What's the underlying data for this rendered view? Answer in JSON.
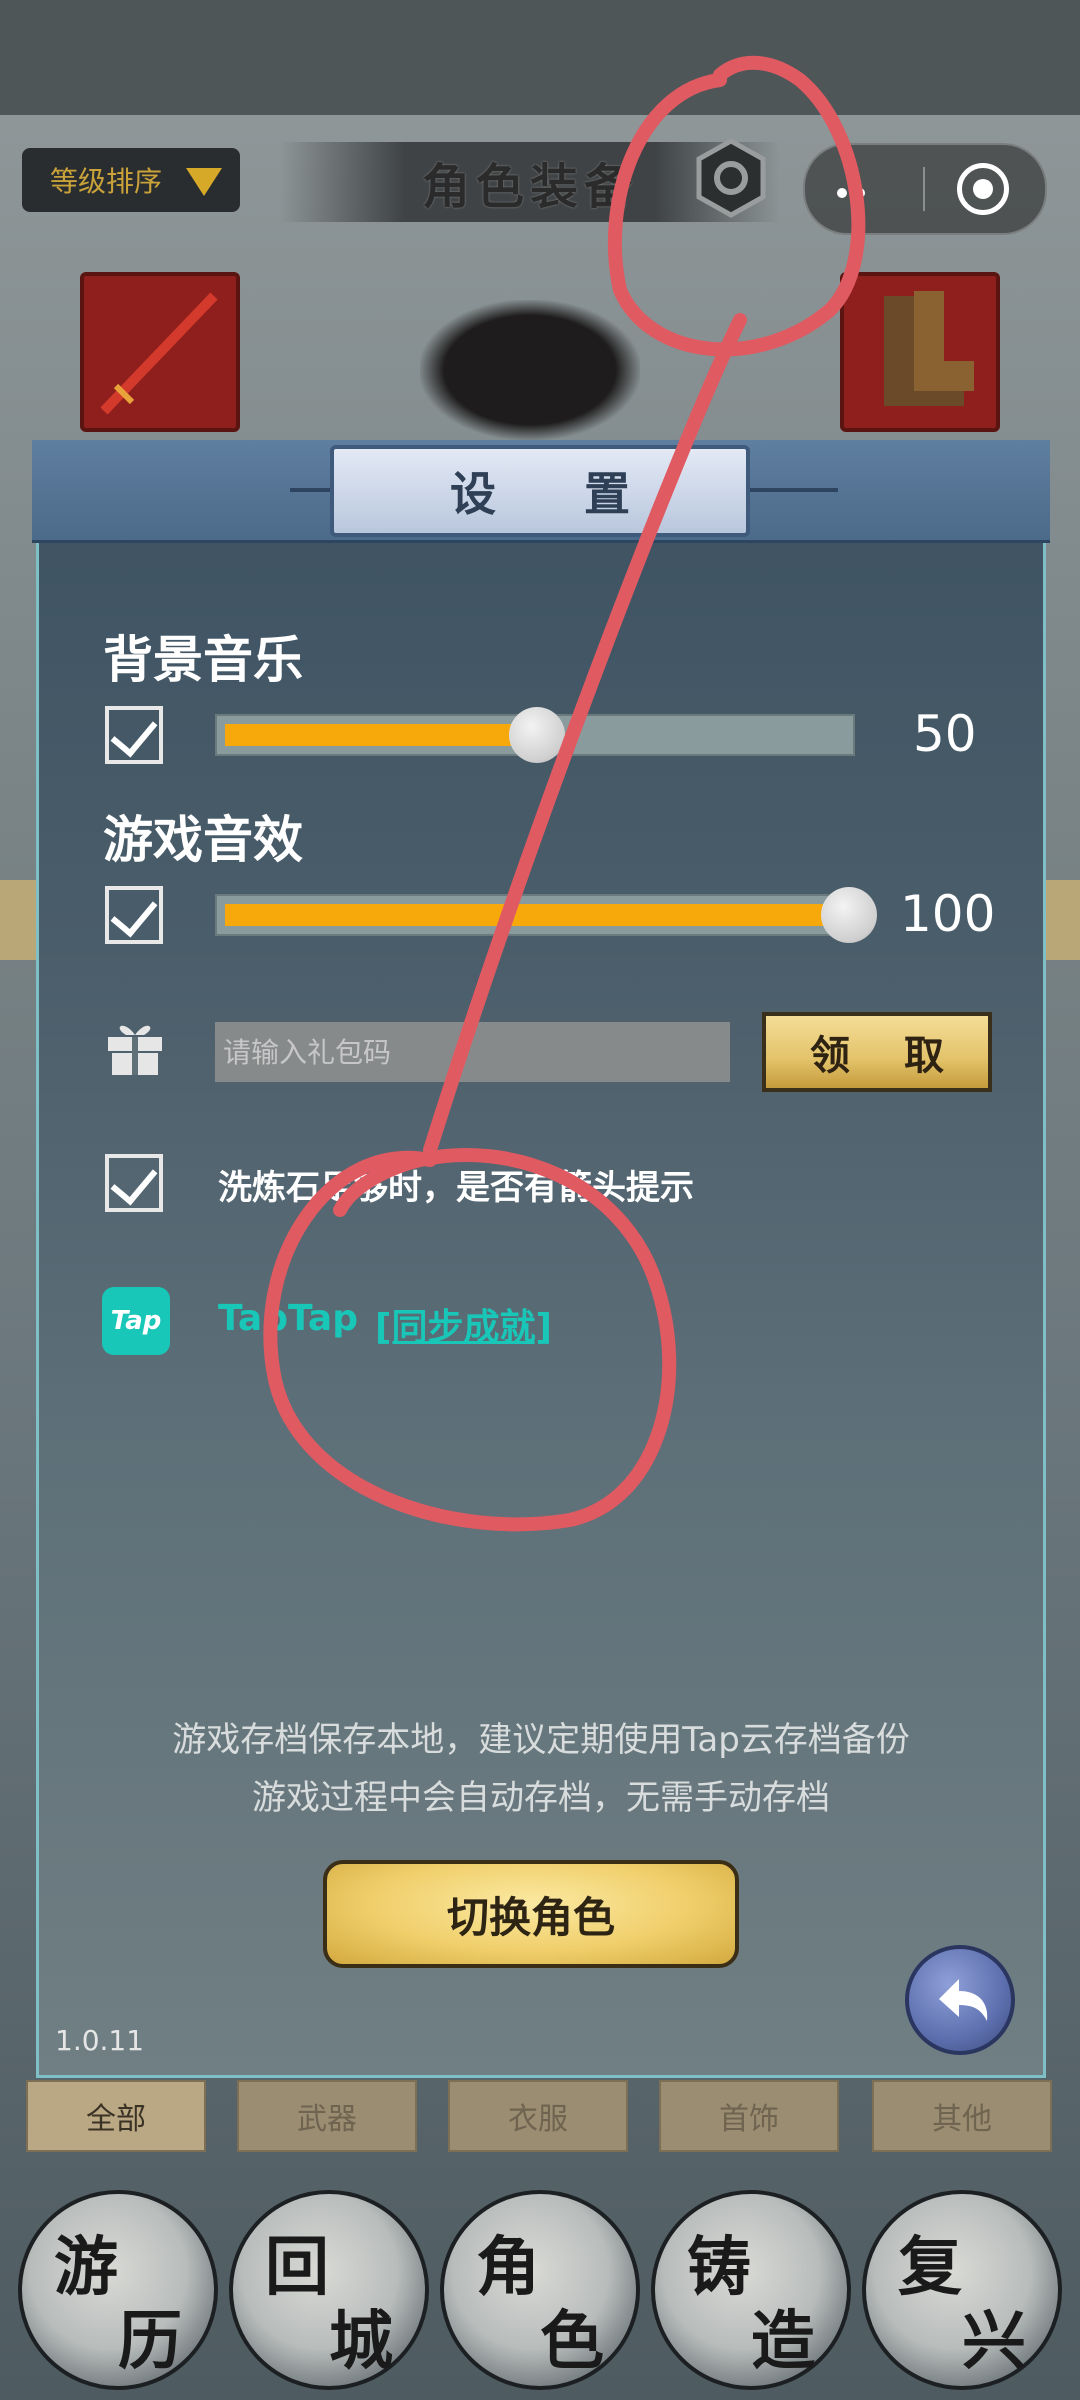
{
  "header": {
    "sort_label": "等级排序",
    "title": "角色装备"
  },
  "settings": {
    "title": "设 置",
    "bgm_label": "背景音乐",
    "bgm_value": "50",
    "bgm_level": 0.5,
    "sfx_label": "游戏音效",
    "sfx_value": "100",
    "sfx_level": 1.0,
    "gift_placeholder": "请输入礼包码",
    "claim_label": "领 取",
    "arrow_tip_label": "洗炼石足够时，是否有箭头提示",
    "taptap_name": "TapTap",
    "sync_label": "[同步成就]",
    "notice_line1": "游戏存档保存本地，建议定期使用Tap云存档备份",
    "notice_line2": "游戏过程中会自动存档，无需手动存档",
    "switch_role_label": "切换角色",
    "version": "1.0.11"
  },
  "category_tabs": [
    "全部",
    "武器",
    "衣服",
    "首饰",
    "其他"
  ],
  "nav": [
    {
      "c1": "游",
      "c2": "历"
    },
    {
      "c1": "回",
      "c2": "城"
    },
    {
      "c1": "角",
      "c2": "色"
    },
    {
      "c1": "铸",
      "c2": "造"
    },
    {
      "c1": "复",
      "c2": "兴"
    }
  ],
  "colors": {
    "slider_fill": "#f7a90b",
    "taptap": "#19c7b8",
    "annotation": "#e05a62"
  },
  "icons": [
    "gear-icon",
    "more-dots-icon",
    "target-icon",
    "checkbox-icon",
    "gift-icon",
    "taptap-logo-icon",
    "back-arrow-icon"
  ]
}
